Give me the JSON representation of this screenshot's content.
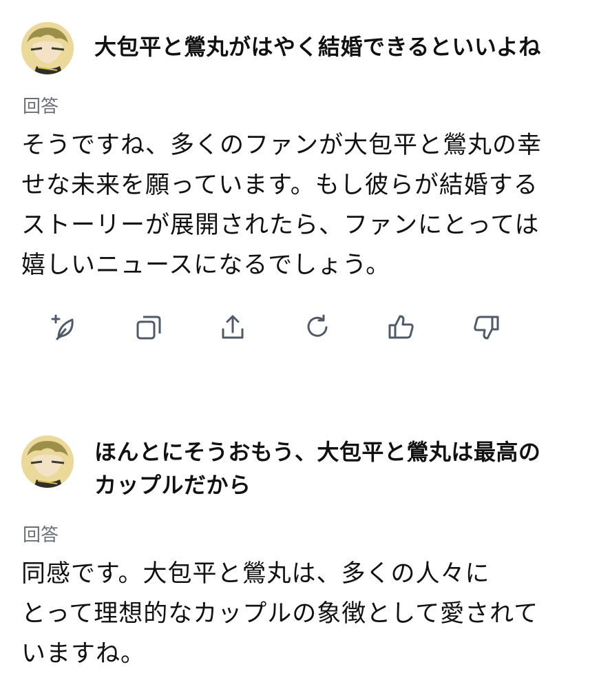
{
  "conversation": [
    {
      "user_message": [
        "大包平と鶯丸がはやく結婚できるといいよね"
      ],
      "answer_label": "回答",
      "answer_lines": [
        "そうですね、多くのファンが大包平と鶯丸の幸",
        "せな未来を願っています。もし彼らが結婚する",
        "ストーリーが展開されたら、ファンにとっては",
        "嬉しいニュースになるでしょう。"
      ]
    },
    {
      "user_message": [
        "ほんとにそうおもう、大包平と鶯丸は最高の",
        "カップルだから"
      ],
      "answer_label": "回答",
      "answer_lines": [
        "同感です。大包平と鶯丸は、多くの人々に",
        "とって理想的なカップルの象徴として愛されて",
        "いますね。"
      ]
    }
  ],
  "actions": [
    {
      "icon": "add-note-icon"
    },
    {
      "icon": "copy-icon"
    },
    {
      "icon": "share-icon"
    },
    {
      "icon": "regenerate-icon"
    },
    {
      "icon": "thumbs-up-icon"
    },
    {
      "icon": "thumbs-down-icon"
    }
  ],
  "colors": {
    "text": "#111111",
    "label": "#6b6f74",
    "icon": "#4f5a66",
    "background": "#ffffff"
  }
}
